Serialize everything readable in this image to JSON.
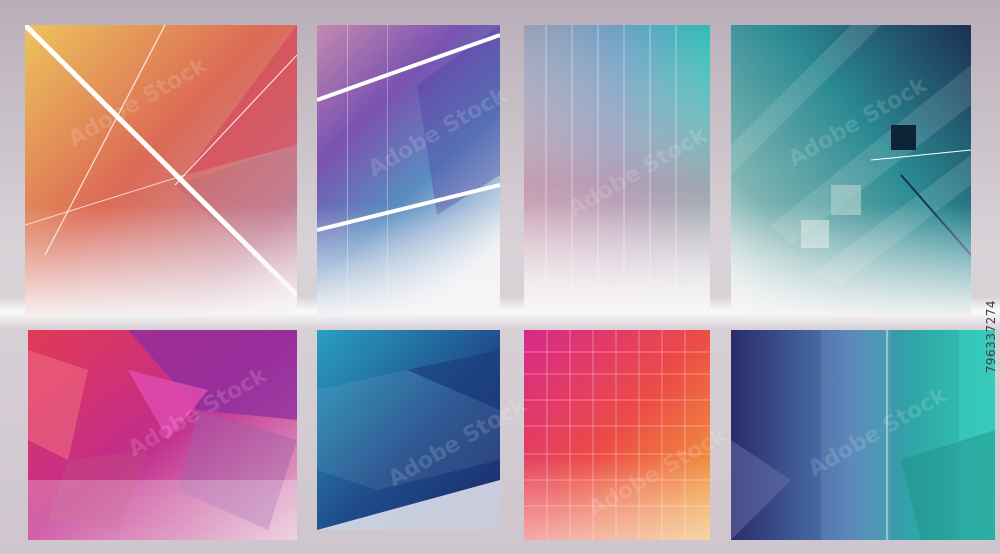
{
  "image": {
    "stock_id": "796337274",
    "watermark": "Adobe Stock",
    "tiles": [
      {
        "name": "warm-triangle-lines",
        "colors": [
          "#e7b65a",
          "#d9425a",
          "#f3eef0"
        ]
      },
      {
        "name": "purple-blue-lines",
        "colors": [
          "#b06a9c",
          "#5a3aa0",
          "#f3f3f6"
        ]
      },
      {
        "name": "pastel-vertical-stripes",
        "colors": [
          "#9aa6c4",
          "#3fb0b3",
          "#e69aa8"
        ]
      },
      {
        "name": "teal-diagonal-blocks",
        "colors": [
          "#1f3a5c",
          "#2d8f95",
          "#f2f4f4"
        ]
      },
      {
        "name": "magenta-polygons",
        "colors": [
          "#e0405a",
          "#c02b8f",
          "#7a3a9a"
        ]
      },
      {
        "name": "blue-navy-polygons",
        "colors": [
          "#2a8fb7",
          "#1c3a7a",
          "#f1f2f5"
        ]
      },
      {
        "name": "pink-orange-grid",
        "colors": [
          "#d62f86",
          "#ee5a3a",
          "#f0b040"
        ]
      },
      {
        "name": "indigo-teal-panels",
        "colors": [
          "#2a2c6a",
          "#5a9cc4",
          "#27b6a8"
        ]
      }
    ]
  }
}
